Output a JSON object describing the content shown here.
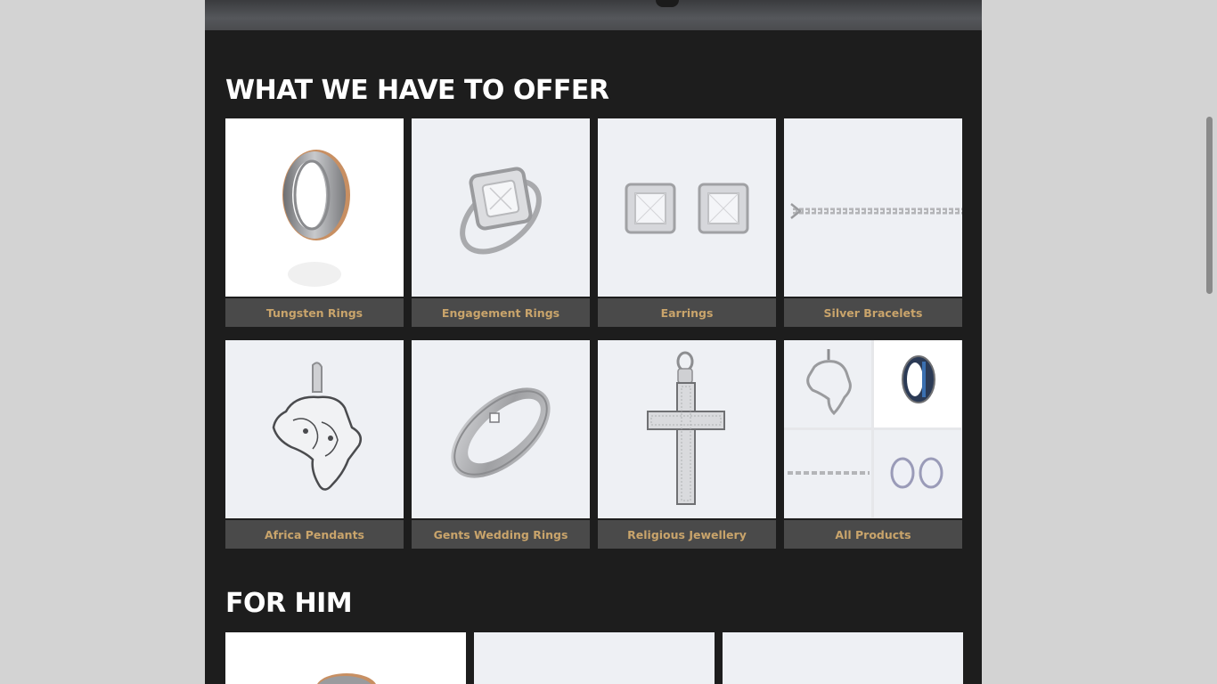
{
  "sections": {
    "offer": {
      "title": "WHAT WE HAVE TO OFFER",
      "items": [
        {
          "label": "Tungsten Rings",
          "icon": "tungsten-ring-image"
        },
        {
          "label": "Engagement Rings",
          "icon": "engagement-ring-image"
        },
        {
          "label": "Earrings",
          "icon": "earrings-image"
        },
        {
          "label": "Silver Bracelets",
          "icon": "bracelet-image"
        },
        {
          "label": "Africa Pendants",
          "icon": "africa-pendant-image"
        },
        {
          "label": "Gents Wedding Rings",
          "icon": "gents-ring-image"
        },
        {
          "label": "Religious Jewellery",
          "icon": "cross-pendant-image"
        },
        {
          "label": "All Products",
          "icon": "collage-image"
        }
      ]
    },
    "for_him": {
      "title": "FOR HIM"
    }
  },
  "colors": {
    "page_bg": "#1d1d1d",
    "outer_bg": "#d3d3d3",
    "label_bg": "#4a4a4a",
    "label_text": "#c9a46b",
    "title_text": "#ffffff"
  }
}
